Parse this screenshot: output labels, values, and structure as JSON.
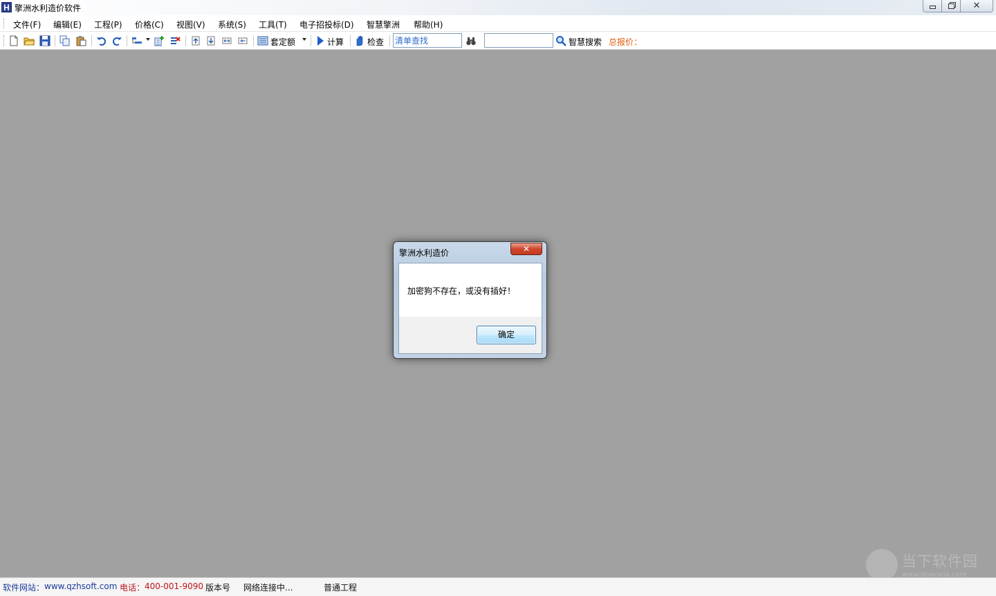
{
  "window": {
    "app_icon_letter": "H",
    "title": "擎洲水利造价软件",
    "controls": {
      "close": "✕"
    }
  },
  "menu": [
    {
      "label": "文件(F)"
    },
    {
      "label": "编辑(E)"
    },
    {
      "label": "工程(P)"
    },
    {
      "label": "价格(C)"
    },
    {
      "label": "视图(V)"
    },
    {
      "label": "系统(S)"
    },
    {
      "label": "工具(T)"
    },
    {
      "label": "电子招投标(D)"
    },
    {
      "label": "智慧擎洲"
    },
    {
      "label": "帮助(H)"
    }
  ],
  "toolbar": {
    "quota_label": "套定额",
    "calc_label": "计算",
    "check_label": "检查",
    "find_value": "清单查找",
    "search_value": "",
    "smart_search_label": "智慧搜索",
    "total_price_label": "总报价："
  },
  "dialog": {
    "title": "擎洲水利造价",
    "close_glyph": "✕",
    "message": "加密狗不存在，或没有插好！",
    "ok_label": "确定"
  },
  "status": {
    "site_label": "软件网站：",
    "site_url": "www.qzhsoft.com",
    "phone_label": "电话：",
    "phone": "400-001-9090",
    "version_label": "版本号",
    "network": "网络连接中...",
    "project_type": "普通工程"
  },
  "watermark": {
    "text": "当下软件园",
    "sub": "www.downxia.com"
  },
  "colors": {
    "workspace": "#a1a1a1",
    "link_blue": "#1c3a9a",
    "phone_red": "#c0141b",
    "total_orange": "#e05a10"
  }
}
